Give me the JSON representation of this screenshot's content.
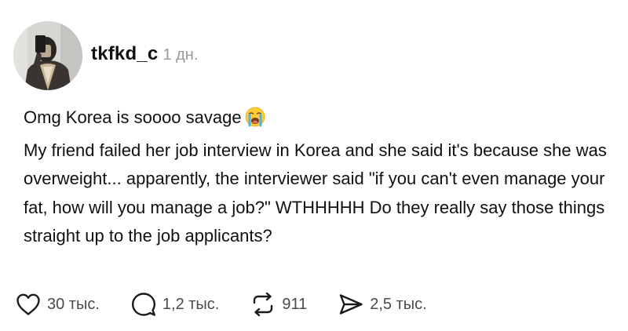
{
  "post": {
    "username": "tkfkd_c",
    "timestamp": "1 дн.",
    "lines": [
      "Omg Korea is soooo savage",
      "My friend failed her job interview in Korea and she said it's because she was overweight... apparently, the interviewer said \"if you can't even manage your fat, how will you manage a job?\" WTHHHHH Do they really say those things straight up to the job applicants?"
    ],
    "emoji_icon": "loudly-crying-face"
  },
  "actions": {
    "like": {
      "icon": "heart-icon",
      "count": "30 тыс."
    },
    "comment": {
      "icon": "comment-bubble-icon",
      "count": "1,2 тыс."
    },
    "repost": {
      "icon": "repost-icon",
      "count": "911"
    },
    "share": {
      "icon": "send-icon",
      "count": "2,5 тыс."
    }
  }
}
